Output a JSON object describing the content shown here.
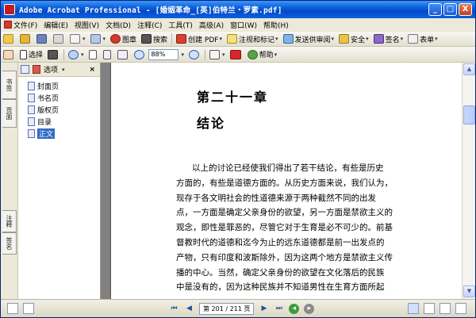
{
  "window": {
    "title": "Adobe Acrobat Professional - [婚姻革命_[英]伯特兰・罗素.pdf]",
    "controls": [
      "_",
      "□",
      "X"
    ]
  },
  "menu": [
    {
      "label": "文件(F)",
      "icon": "document-icon"
    },
    {
      "label": "编辑(E)"
    },
    {
      "label": "视图(V)"
    },
    {
      "label": "文档(D)"
    },
    {
      "label": "注释(C)"
    },
    {
      "label": "工具(T)"
    },
    {
      "label": "高级(A)"
    },
    {
      "label": "窗口(W)"
    },
    {
      "label": "帮助(H)"
    }
  ],
  "toolbar1": {
    "print_label": "图章",
    "search_label": "搜索",
    "create_pdf_label": "创建 PDF",
    "comment_label": "注视和标记",
    "send_review_label": "发送供审阅",
    "security_label": "安全",
    "sign_label": "签名",
    "forms_label": "表单"
  },
  "toolbar2": {
    "select_label": "选择",
    "zoom_value": "88%",
    "help_label": "帮助"
  },
  "left_tabs": [
    {
      "label": "书签"
    },
    {
      "label": "页面"
    },
    {
      "label": "注释"
    },
    {
      "label": "签名"
    }
  ],
  "panel": {
    "options_label": "选项",
    "close_label": "×",
    "bookmarks": [
      {
        "label": "封面页",
        "selected": false
      },
      {
        "label": "书名页",
        "selected": false
      },
      {
        "label": "版权页",
        "selected": false
      },
      {
        "label": "目录",
        "selected": false
      },
      {
        "label": "正文",
        "selected": true
      }
    ]
  },
  "document": {
    "chapter": "第二十一章",
    "section": "结论",
    "lines": [
      "以上的讨论已经使我们得出了若干结论，有些是历史",
      "方面的，有些是道德方面的。从历史方面来说，我们认为，",
      "现存于各文明社会的性道德来源于两种截然不同的出发",
      "点，一方面是确定父亲身份的欲望，另一方面是禁欲主义的",
      "观念，即性是罪恶的，尽管它对于生育是必不可少的。前基",
      "督教时代的道德和迄今为止的远东道德都是前一出发点的",
      "产物，只有印度和波斯除外，因为这两个地方是禁欲主义传",
      "播的中心。当然，确定父亲身份的欲望在文化落后的民族",
      "中是没有的，因为这种民族并不知道男性在生育方面所起"
    ]
  },
  "statusbar": {
    "page_indicator": "第 201 / 211 页"
  },
  "colors": {
    "title_bar": "#0a5fd8",
    "selection": "#316ac5",
    "chrome": "#ece9d8"
  }
}
